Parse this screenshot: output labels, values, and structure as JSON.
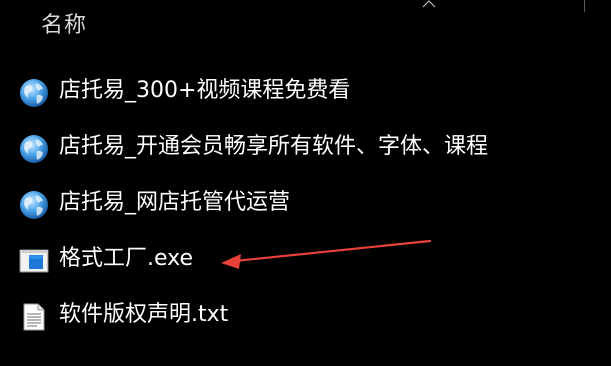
{
  "header": {
    "name_column": "名称"
  },
  "files": [
    {
      "name": "店托易_300+视频课程免费看",
      "icon": "globe-icon"
    },
    {
      "name": "店托易_开通会员畅享所有软件、字体、课程",
      "icon": "globe-icon"
    },
    {
      "name": "店托易_网店托管代运营",
      "icon": "globe-icon"
    },
    {
      "name": "格式工厂.exe",
      "icon": "exe-app-icon"
    },
    {
      "name": "软件版权声明.txt",
      "icon": "text-file-icon"
    }
  ],
  "colors": {
    "background": "#000000",
    "text": "#ffffff",
    "header_text": "#d8d8d8",
    "annotation_arrow": "#e8413a"
  }
}
